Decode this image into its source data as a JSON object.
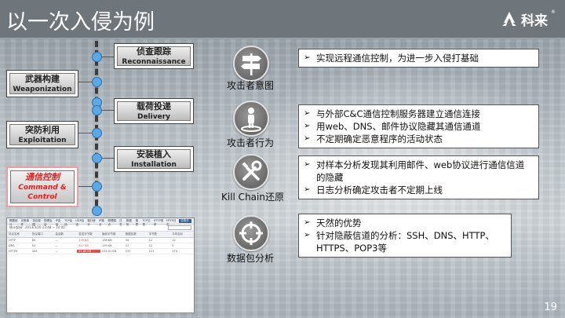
{
  "header": {
    "title": "以一次入侵为例",
    "logo_text": "科来",
    "logo_reg": "®"
  },
  "stages": [
    {
      "cn": "侦查跟踪",
      "en": "Reconnaissance",
      "active": false
    },
    {
      "cn": "武器构建",
      "en": "Weaponization",
      "active": false
    },
    {
      "cn": "载荷投递",
      "en": "Delivery",
      "active": false
    },
    {
      "cn": "突防利用",
      "en": "Exploitation",
      "active": false
    },
    {
      "cn": "安装植入",
      "en": "Installation",
      "active": false
    },
    {
      "cn": "通信控制",
      "en": "Command &",
      "en2": "Control",
      "active": true
    }
  ],
  "screenshot": {
    "menu": [
      "概要统计",
      "诊断事件",
      "协议视图",
      "物理会话",
      "IP会话",
      "TCP会话",
      "UDP会话",
      "端口统计",
      "IP端点",
      "物理端点",
      "日志",
      "数据包",
      "报表",
      "TCP交易",
      "HTTP请求",
      "HTTP日志",
      "应用分析"
    ],
    "menu_selected": "应用分析",
    "toolbar_text": "统计起始：2013/3/26 13:48 ~ 14:00",
    "columns": [
      "协议名称",
      "协议端口",
      "会话数",
      "发送字节数",
      "接收字节数",
      "数据包数",
      "字节数",
      "平均包长"
    ],
    "rows": [
      [
        "HTTP",
        "80",
        "—",
        "139 KB",
        "138 KB",
        "34",
        "12",
        "12"
      ],
      [
        "DNS",
        "53",
        "—",
        "847 KB",
        "139 KB",
        "27",
        "12",
        "5"
      ],
      [
        "HTTPS",
        "443",
        "—",
        "21.84 KB",
        "232.01 KB",
        "237",
        "121",
        "174"
      ]
    ]
  },
  "rows": [
    {
      "label": "攻击者意图",
      "icon": "signpost-icon",
      "items": [
        "实现远程通信控制，为进一步入侵打基础"
      ]
    },
    {
      "label": "攻击者行为",
      "icon": "person-pin-icon",
      "items": [
        "与外部C&C通信控制服务器建立通信连接",
        "用web、DNS、邮件协议隐藏其通信通道",
        "不定期确定恶意程序的活动状态"
      ]
    },
    {
      "label": "Kill Chain还原",
      "icon": "tools-icon",
      "items": [
        "对样本分析发现其利用邮件、web协议进行通信信道的隐藏",
        "日志分析确定攻击者不定期上线"
      ]
    },
    {
      "label": "数据包分析",
      "icon": "crosshair-icon",
      "items": [
        "天然的优势",
        "针对隐蔽信道的分析：SSH、DNS、HTTP、HTTPS、POP3等"
      ]
    }
  ],
  "bullet": "➢",
  "page_number": "19",
  "colors": {
    "header_bg": "#6e757b",
    "timeline_dot": "#5aa8e6",
    "active_stage_text": "#e02020"
  }
}
